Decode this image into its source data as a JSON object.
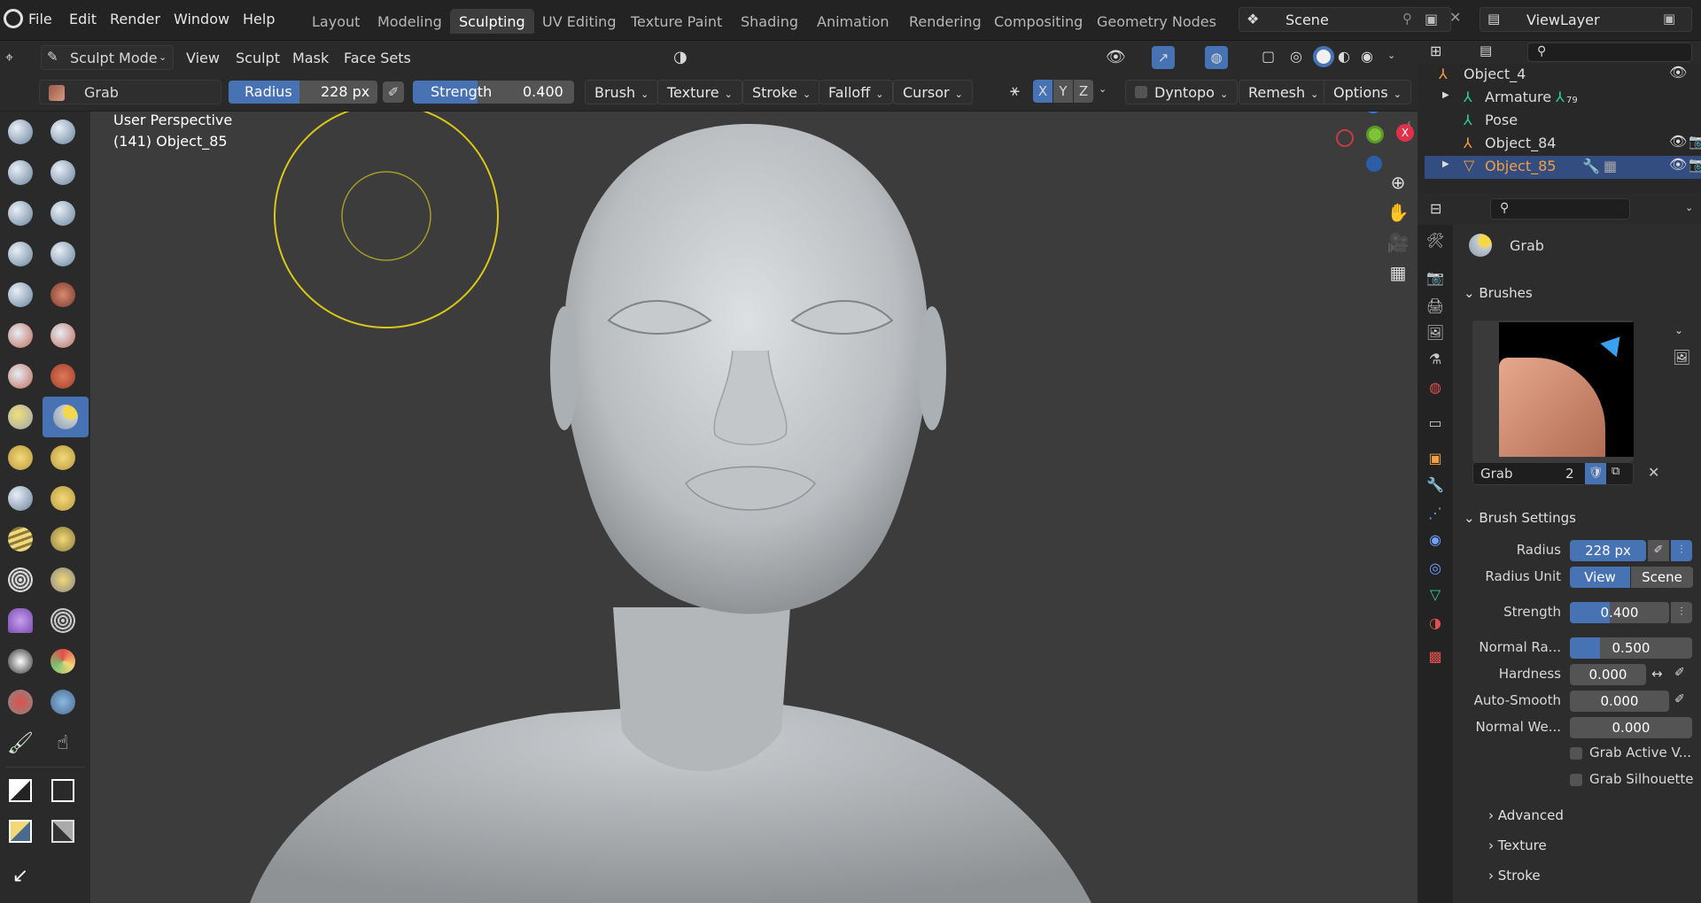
{
  "menu": {
    "file": "File",
    "edit": "Edit",
    "render": "Render",
    "window": "Window",
    "help": "Help"
  },
  "workspaces": [
    "Layout",
    "Modeling",
    "Sculpting",
    "UV Editing",
    "Texture Paint",
    "Shading",
    "Animation",
    "Rendering",
    "Compositing",
    "Geometry Nodes"
  ],
  "active_workspace": "Sculpting",
  "scene": {
    "label": "Scene",
    "view_layer": "ViewLayer"
  },
  "header": {
    "mode": "Sculpt Mode",
    "view": "View",
    "sculpt": "Sculpt",
    "mask": "Mask",
    "face_sets": "Face Sets"
  },
  "toolsettings": {
    "brush_name": "Grab",
    "radius_label": "Radius",
    "radius_value": "228 px",
    "strength_label": "Strength",
    "strength_value": "0.400",
    "menus": [
      "Brush",
      "Texture",
      "Stroke",
      "Falloff",
      "Cursor"
    ],
    "axes": [
      "X",
      "Y",
      "Z"
    ],
    "dyntopo": "Dyntopo",
    "remesh": "Remesh",
    "options": "Options"
  },
  "viewport": {
    "perspective": "User Perspective",
    "object": "(141) Object_85",
    "gizmo_z": "Z",
    "gizmo_x": "X"
  },
  "outliner": {
    "rows": [
      {
        "name": "Object_4",
        "badge": ""
      },
      {
        "name": "Armature",
        "badge": "79"
      },
      {
        "name": "Pose",
        "badge": ""
      },
      {
        "name": "Object_84",
        "badge": ""
      },
      {
        "name": "Object_85",
        "badge": ""
      }
    ]
  },
  "properties": {
    "brush_title": "Grab",
    "brushes_section": "Brushes",
    "brush_slot_name": "Grab",
    "brush_users": "2",
    "brush_settings_section": "Brush Settings",
    "radius_label": "Radius",
    "radius_value": "228 px",
    "radius_unit_label": "Radius Unit",
    "unit_view": "View",
    "unit_scene": "Scene",
    "strength_label": "Strength",
    "strength_value": "0.400",
    "normal_radius_label": "Normal Ra...",
    "normal_radius_value": "0.500",
    "hardness_label": "Hardness",
    "hardness_value": "0.000",
    "autosmooth_label": "Auto-Smooth",
    "autosmooth_value": "0.000",
    "normal_weight_label": "Normal We...",
    "normal_weight_value": "0.000",
    "grab_active_label": "Grab Active V...",
    "grab_silhouette_label": "Grab Silhouette",
    "advanced": "Advanced",
    "texture": "Texture",
    "stroke": "Stroke"
  },
  "colors": {
    "accent": "#4772b3",
    "selected_row": "#334d80",
    "orange_text": "#f0a040",
    "cursor_yellow": "#d9c81a"
  }
}
